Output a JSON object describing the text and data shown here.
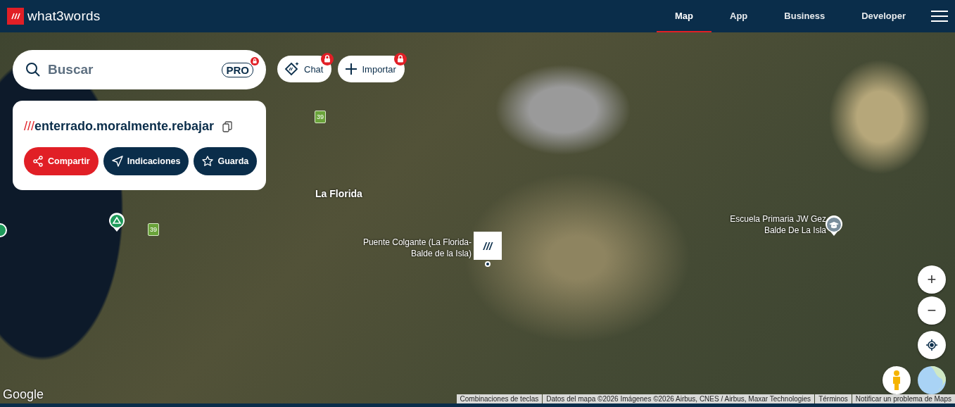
{
  "header": {
    "logo_text": "what3words",
    "nav": [
      {
        "label": "Map",
        "selected": true
      },
      {
        "label": "App",
        "selected": false
      },
      {
        "label": "Business",
        "selected": false
      },
      {
        "label": "Developer",
        "selected": false
      }
    ]
  },
  "search": {
    "placeholder": "Buscar",
    "pro_badge": "PRO",
    "locked": true
  },
  "tool_buttons": [
    {
      "kind": "chat",
      "label": "Chat",
      "locked": true
    },
    {
      "kind": "import",
      "label": "Importar",
      "locked": true
    }
  ],
  "location_card": {
    "slashes": "///",
    "address": "enterrado.moralmente.rebajar",
    "actions": [
      {
        "kind": "share",
        "label": "Compartir"
      },
      {
        "kind": "directions",
        "label": "Indicaciones"
      },
      {
        "kind": "save",
        "label": "Guarda"
      }
    ]
  },
  "map": {
    "labels": [
      {
        "kind": "route",
        "text": "39"
      },
      {
        "kind": "route",
        "text": "39"
      },
      {
        "kind": "town",
        "text": "La Florida"
      },
      {
        "kind": "place",
        "text": "Puente Colgante (La Florida-Balde de la Isla)"
      },
      {
        "kind": "place",
        "text": "Escuela Primaria JW Gez Balde De La Isla"
      }
    ],
    "marker_slashes": "///",
    "google_logo": "Google",
    "attribution": [
      "Combinaciones de teclas",
      "Datos del mapa ©2026 Imágenes ©2026 Airbus, CNES / Airbus, Maxar Technologies",
      "Términos",
      "Notificar un problema de Maps"
    ],
    "zoom_in": "+",
    "zoom_out": "−"
  }
}
